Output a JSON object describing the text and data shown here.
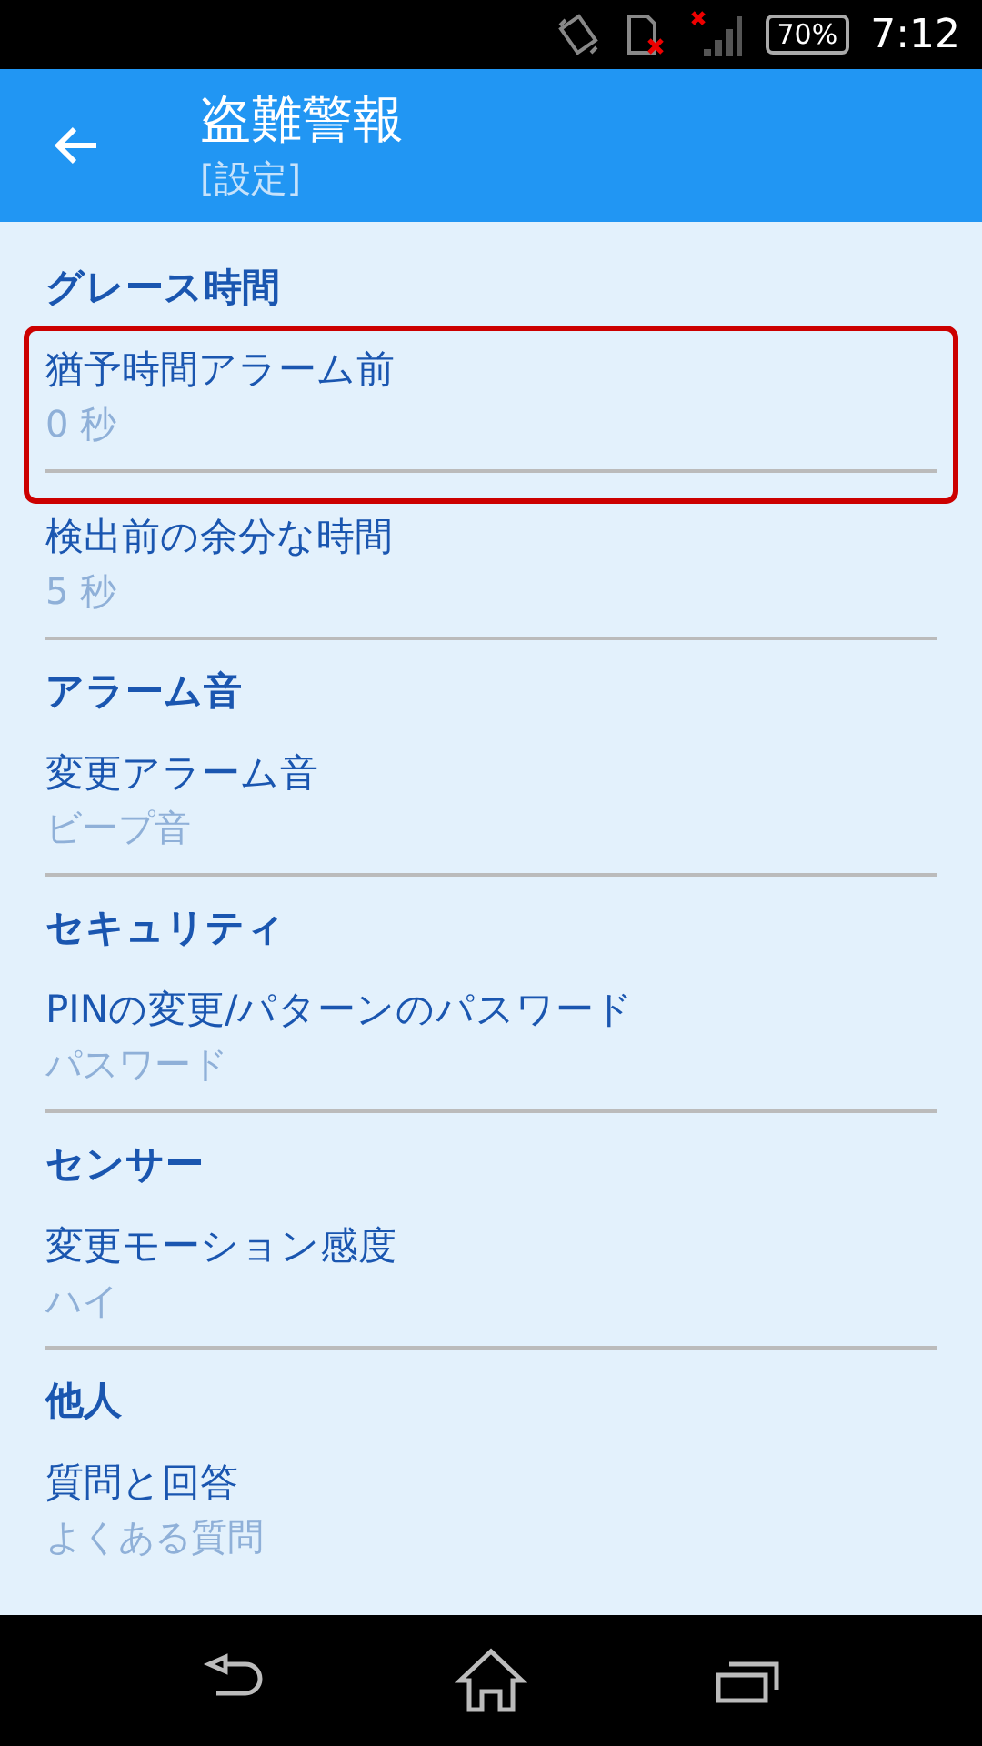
{
  "status_bar": {
    "battery": "70%",
    "time": "7:12"
  },
  "app_bar": {
    "title": "盗難警報",
    "subtitle": "[設定]"
  },
  "sections": [
    {
      "title": "グレース時間",
      "items": [
        {
          "title": "猶予時間アラーム前",
          "summary": "0 秒",
          "highlighted": true
        },
        {
          "title": "検出前の余分な時間",
          "summary": "5 秒",
          "highlighted": false
        }
      ]
    },
    {
      "title": "アラーム音",
      "items": [
        {
          "title": "変更アラーム音",
          "summary": "ビープ音",
          "highlighted": false
        }
      ]
    },
    {
      "title": "セキュリティ",
      "items": [
        {
          "title": "PINの変更/パターンのパスワード",
          "summary": "パスワード",
          "highlighted": false
        }
      ]
    },
    {
      "title": "センサー",
      "items": [
        {
          "title": "変更モーション感度",
          "summary": "ハイ",
          "highlighted": false
        }
      ]
    },
    {
      "title": "他人",
      "items": [
        {
          "title": "質問と回答",
          "summary": "よくある質問",
          "highlighted": false
        }
      ]
    }
  ]
}
